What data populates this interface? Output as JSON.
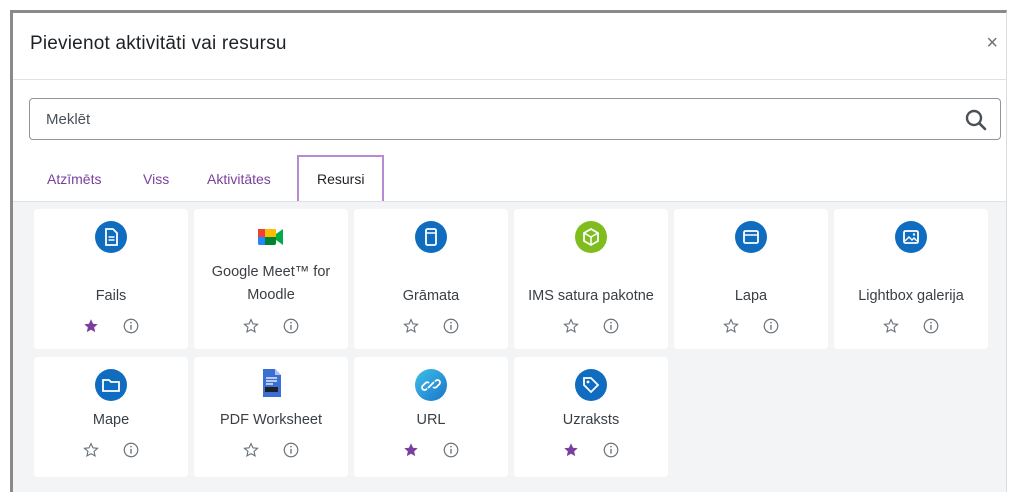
{
  "dialog": {
    "title": "Pievienot aktivitāti vai resursu",
    "close_symbol": "×"
  },
  "search": {
    "placeholder": "Meklēt",
    "value": ""
  },
  "tabs": [
    {
      "label": "Atzīmēts",
      "active": false
    },
    {
      "label": "Viss",
      "active": false
    },
    {
      "label": "Aktivitātes",
      "active": false
    },
    {
      "label": "Resursi",
      "active": true
    }
  ],
  "colors": {
    "accent": "#7a3f9d",
    "icon_blue": "#0f6cbf",
    "icon_green": "#7fbd1f",
    "starred": "#7a3f9d"
  },
  "items": [
    {
      "name": "Fails",
      "icon": "file-icon",
      "starred": true
    },
    {
      "name": "Google Meet™ for Moodle",
      "icon": "google-meet-icon",
      "starred": false
    },
    {
      "name": "Grāmata",
      "icon": "book-icon",
      "starred": false
    },
    {
      "name": "IMS satura pakotne",
      "icon": "package-icon",
      "starred": false
    },
    {
      "name": "Lapa",
      "icon": "page-icon",
      "starred": false
    },
    {
      "name": "Lightbox galerija",
      "icon": "gallery-icon",
      "starred": false
    },
    {
      "name": "Mape",
      "icon": "folder-icon",
      "starred": false
    },
    {
      "name": "PDF Worksheet",
      "icon": "pdf-worksheet-icon",
      "starred": false
    },
    {
      "name": "URL",
      "icon": "link-icon",
      "starred": true
    },
    {
      "name": "Uzraksts",
      "icon": "label-icon",
      "starred": true
    }
  ]
}
